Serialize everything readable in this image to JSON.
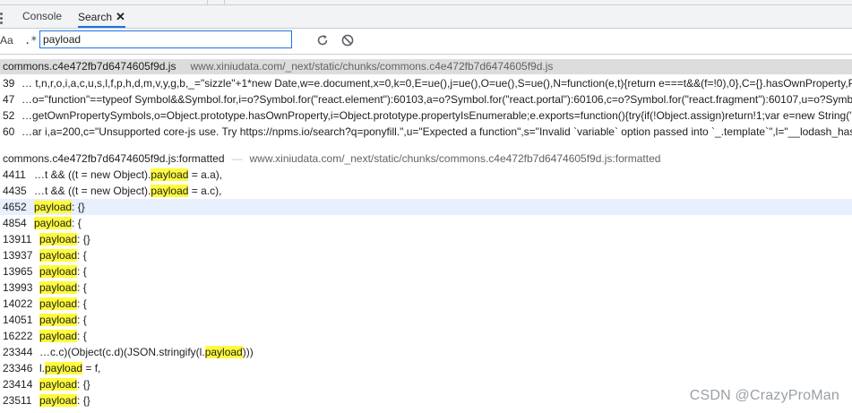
{
  "tabs": [
    {
      "label": "Console"
    },
    {
      "label": "Search",
      "close": "✕"
    }
  ],
  "toolbar": {
    "match_case_label": "Aa",
    "regex_label": ".*",
    "search_value": "payload",
    "refresh_icon": "refresh-icon",
    "clear_icon": "clear-icon"
  },
  "group1": {
    "file": "commons.c4e472fb7d6474605f9d.js",
    "path": "www.xiniudata.com/_next/static/chunks/commons.c4e472fb7d6474605f9d.js",
    "rows": [
      {
        "line": "39",
        "pre": "… t,n,r,o,i,a,c,u,s,l,f,p,h,d,m,v,y,g,b,_=\"sizzle\"+1*new Date,w=e.document,x=0,k=0,E=ue(),j=ue(),O=ue(),S=ue(),N=function(e,t){return e===t&&(f=!0),0},C={}.hasOwnProperty,P=[],",
        "hl": "",
        "post": ""
      },
      {
        "line": "47",
        "pre": "…o=\"function\"==typeof Symbol&&Symbol.for,i=o?Symbol.for(\"react.element\"):60103,a=o?Symbol.for(\"react.portal\"):60106,c=o?Symbol.for(\"react.fragment\"):60107,u=o?Symbol.",
        "hl": "",
        "post": ""
      },
      {
        "line": "52",
        "pre": "…getOwnPropertySymbols,o=Object.prototype.hasOwnProperty,i=Object.prototype.propertyIsEnumerable;e.exports=function(){try{if(!Object.assign)return!1;var e=new String(\"a",
        "hl": "",
        "post": ""
      },
      {
        "line": "60",
        "pre": "…ar i,a=200,c=\"Unsupported core-js use. Try https://npms.io/search?q=ponyfill.\",u=\"Expected a function\",s=\"Invalid `variable` option passed into `_.template`\",l=\"__lodash_hash",
        "hl": "",
        "post": ""
      }
    ]
  },
  "group2": {
    "file": "commons.c4e472fb7d6474605f9d.js:formatted",
    "path": "www.xiniudata.com/_next/static/chunks/commons.c4e472fb7d6474605f9d.js:formatted",
    "rows": [
      {
        "line": "4411",
        "pre": "…t && ((t = new Object).",
        "hl": "payload",
        "post": " = a.a),"
      },
      {
        "line": "4435",
        "pre": "…t && ((t = new Object).",
        "hl": "payload",
        "post": " = a.c),"
      },
      {
        "line": "4652",
        "pre": "",
        "hl": "payload",
        "post": ": {}"
      },
      {
        "line": "4854",
        "pre": "",
        "hl": "payload",
        "post": ": {"
      },
      {
        "line": "13911",
        "pre": "",
        "hl": "payload",
        "post": ": {}"
      },
      {
        "line": "13937",
        "pre": "",
        "hl": "payload",
        "post": ": {"
      },
      {
        "line": "13965",
        "pre": "",
        "hl": "payload",
        "post": ": {"
      },
      {
        "line": "13993",
        "pre": "",
        "hl": "payload",
        "post": ": {"
      },
      {
        "line": "14022",
        "pre": "",
        "hl": "payload",
        "post": ": {"
      },
      {
        "line": "14051",
        "pre": "",
        "hl": "payload",
        "post": ": {"
      },
      {
        "line": "16222",
        "pre": "",
        "hl": "payload",
        "post": ": {"
      },
      {
        "line": "23344",
        "pre": "…c.c)(Object(c.d)(JSON.stringify(l.",
        "hl": "payload",
        "post": ")))"
      },
      {
        "line": "23346",
        "pre": "l.",
        "hl": "payload",
        "post": " = f,"
      },
      {
        "line": "23414",
        "pre": "",
        "hl": "payload",
        "post": ": {}"
      },
      {
        "line": "23511",
        "pre": "",
        "hl": "payload",
        "post": ": {}"
      }
    ]
  },
  "watermark": "CSDN @CrazyProMan"
}
